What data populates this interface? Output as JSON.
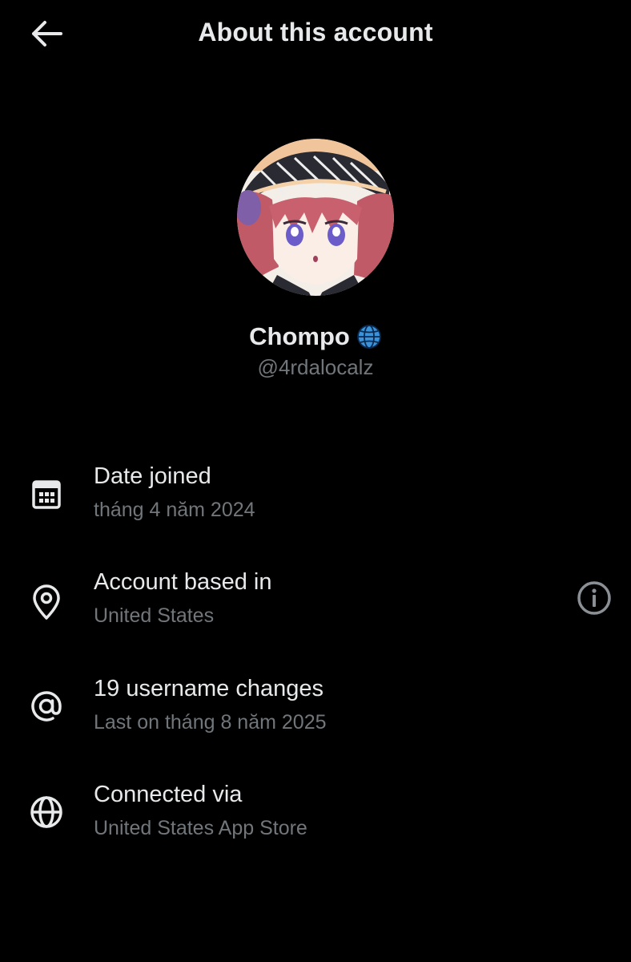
{
  "header": {
    "title": "About this account",
    "back_icon": "arrow-left-icon"
  },
  "profile": {
    "display_name": "Chompo",
    "name_badge_icon": "globe-emoji-icon",
    "handle": "@4rdalocalz",
    "avatar": "anime-avatar"
  },
  "info_items": [
    {
      "icon": "calendar-icon",
      "label": "Date joined",
      "value": "tháng 4 năm 2024"
    },
    {
      "icon": "location-pin-icon",
      "label": "Account based in",
      "value": "United States",
      "action_icon": "info-circle-icon"
    },
    {
      "icon": "at-sign-icon",
      "label": "19 username changes",
      "value": "Last on tháng 8 năm 2025"
    },
    {
      "icon": "globe-icon",
      "label": "Connected via",
      "value": "United States App Store"
    }
  ],
  "colors": {
    "background": "#000000",
    "primary_text": "#e7e9ea",
    "secondary_text": "#71767b",
    "globe_badge": "#3b94d9"
  }
}
